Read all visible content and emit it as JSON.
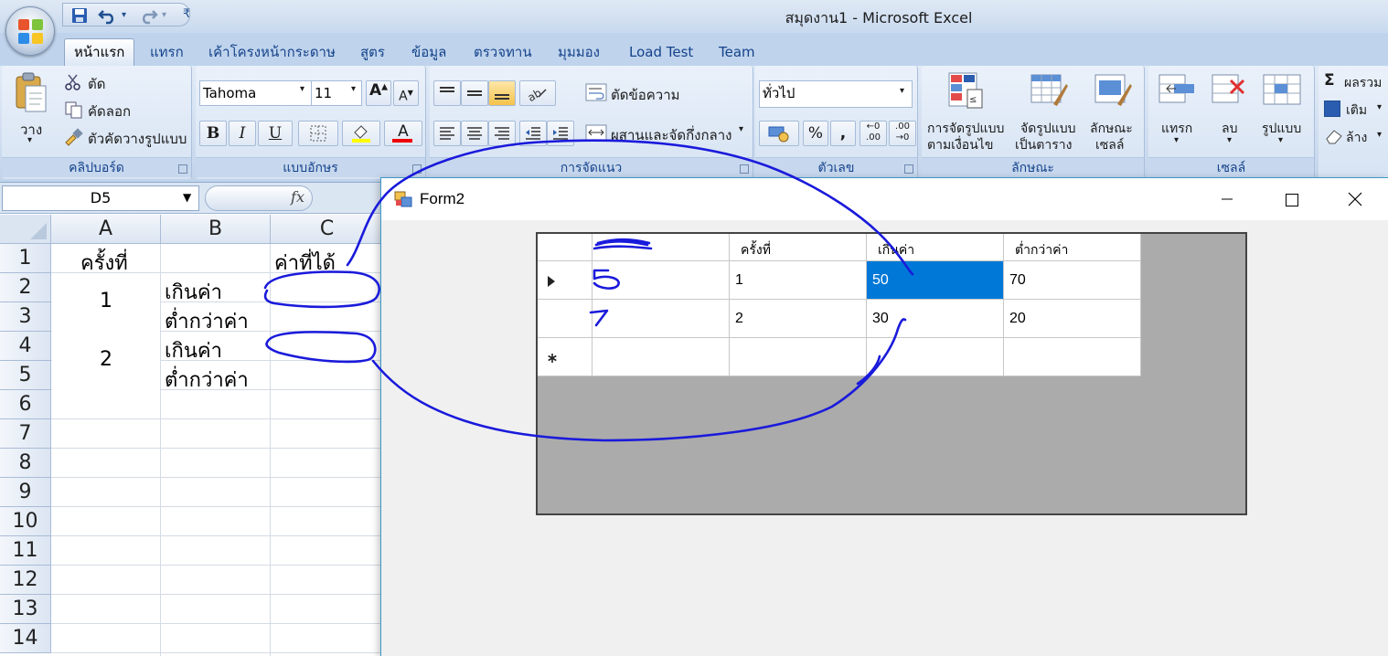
{
  "excel": {
    "title": "สมุดงาน1 - Microsoft Excel",
    "tabs": [
      "หน้าแรก",
      "แทรก",
      "เค้าโครงหน้ากระดาษ",
      "สูตร",
      "ข้อมูล",
      "ตรวจทาน",
      "มุมมอง",
      "Load Test",
      "Team"
    ],
    "ribbon": {
      "clipboard": {
        "paste": "วาง",
        "cut": "ตัด",
        "copy": "คัดลอก",
        "format_painter": "ตัวคัดวางรูปแบบ",
        "label": "คลิปบอร์ด"
      },
      "font": {
        "name": "Tahoma",
        "size": "11",
        "bold": "B",
        "italic": "I",
        "underline": "U",
        "label": "แบบอักษร"
      },
      "alignment": {
        "wrap": "ตัดข้อความ",
        "merge": "ผสานและจัดกึ่งกลาง",
        "label": "การจัดแนว"
      },
      "number": {
        "format": "ทั่วไป",
        "percent": "%",
        "comma": ",",
        "label": "ตัวเลข"
      },
      "styles": {
        "conditional_1": "การจัดรูปแบบ",
        "conditional_2": "ตามเงื่อนไข",
        "table_1": "จัดรูปแบบ",
        "table_2": "เป็นตาราง",
        "cell_1": "ลักษณะ",
        "cell_2": "เซลล์",
        "label": "ลักษณะ"
      },
      "cells": {
        "insert": "แทรก",
        "delete": "ลบ",
        "format": "รูปแบบ",
        "label": "เซลล์"
      },
      "editing": {
        "sum": "ผลรวม",
        "fill": "เติม",
        "clear": "ล้าง"
      }
    },
    "namebox": "D5",
    "fx": "fx",
    "columns": [
      "A",
      "B",
      "C"
    ],
    "rows": [
      "1",
      "2",
      "3",
      "4",
      "5",
      "6",
      "7",
      "8",
      "9",
      "10",
      "11",
      "12",
      "13",
      "14"
    ],
    "cells": {
      "a1": "ครั้งที่",
      "c1": "ค่าที่ได้",
      "a2": "1",
      "b2": "เกินค่า",
      "b3": "ต่ำกว่าค่า",
      "a4": "2",
      "b4": "เกินค่า",
      "b5": "ต่ำกว่าค่า"
    }
  },
  "form2": {
    "title": "Form2",
    "grid": {
      "headers": [
        "",
        "ครั้งที่",
        "เกินค่า",
        "ต่ำกว่าค่า"
      ],
      "rows": [
        [
          "",
          "1",
          "50",
          "70"
        ],
        [
          "",
          "2",
          "30",
          "20"
        ],
        [
          "",
          "",
          "",
          ""
        ]
      ]
    }
  },
  "colors": {
    "excel_blue": "#15428b",
    "selection": "#0078d7",
    "ink": "#1a1adb"
  },
  "icons": [
    "office-button-icon",
    "save-icon",
    "undo-icon",
    "redo-icon",
    "paste-icon",
    "scissors-icon",
    "copy-icon",
    "brush-icon",
    "sum-icon",
    "minimize-icon",
    "maximize-icon",
    "close-icon",
    "row-pointer-icon",
    "new-row-icon"
  ]
}
